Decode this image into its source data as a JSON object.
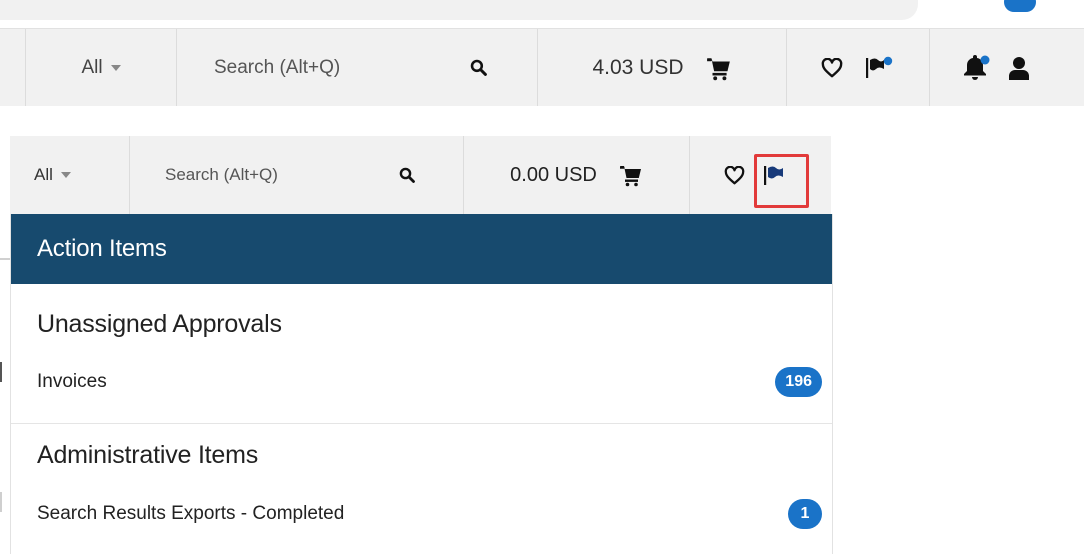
{
  "top_bar": {
    "scope_label": "All",
    "search_placeholder": "Search (Alt+Q)",
    "cart_total": "4.03 USD"
  },
  "menu_bar": {
    "scope_label": "All",
    "search_placeholder": "Search (Alt+Q)",
    "cart_total": "0.00 USD"
  },
  "action_panel": {
    "title": "Action Items",
    "sections": [
      {
        "title": "Unassigned Approvals",
        "items": [
          {
            "label": "Invoices",
            "count": "196"
          }
        ]
      },
      {
        "title": "Administrative Items",
        "items": [
          {
            "label": "Search Results Exports - Completed",
            "count": "1"
          }
        ]
      }
    ]
  },
  "colors": {
    "header_navy": "#174a6e",
    "badge_blue": "#1a73c8",
    "highlight_red": "#e23a3a",
    "bar_gray": "#f1f1f1"
  },
  "icons": [
    "search-icon",
    "cart-icon",
    "heart-icon",
    "flag-icon",
    "bell-icon",
    "user-icon",
    "caret-down-icon"
  ]
}
